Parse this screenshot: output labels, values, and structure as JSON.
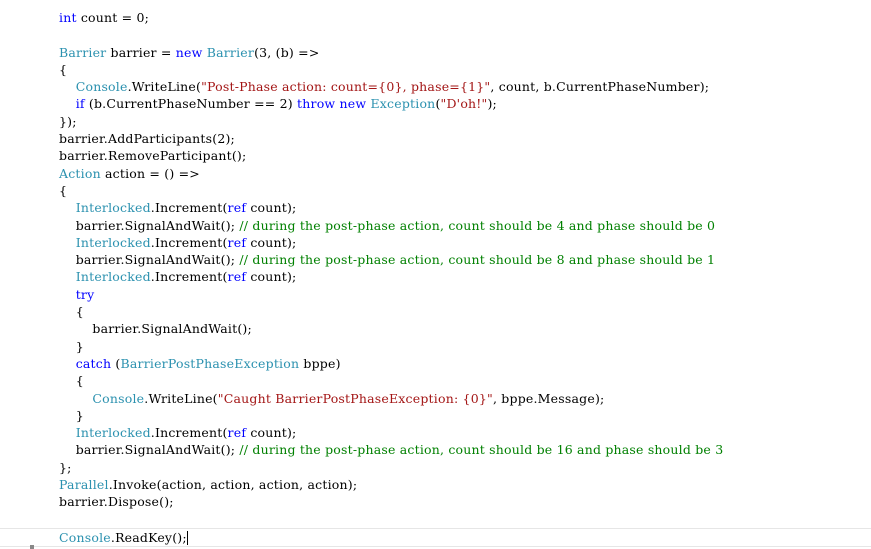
{
  "colors": {
    "keyword": "#0000ff",
    "type": "#2b91af",
    "string": "#a31515",
    "comment": "#008000",
    "plain": "#000000",
    "background": "#ffffff"
  },
  "editor": {
    "caret_line": 31,
    "lines": [
      [
        [
          "kw",
          "int"
        ],
        [
          "pl",
          " count = 0;"
        ]
      ],
      [],
      [
        [
          "ty",
          "Barrier"
        ],
        [
          "pl",
          " barrier = "
        ],
        [
          "kw",
          "new"
        ],
        [
          "pl",
          " "
        ],
        [
          "ty",
          "Barrier"
        ],
        [
          "pl",
          "(3, (b) =>"
        ]
      ],
      [
        [
          "pl",
          "{"
        ]
      ],
      [
        [
          "pl",
          "    "
        ],
        [
          "ty",
          "Console"
        ],
        [
          "pl",
          ".WriteLine("
        ],
        [
          "str",
          "\"Post-Phase action: count={0}, phase={1}\""
        ],
        [
          "pl",
          ", count, b.CurrentPhaseNumber);"
        ]
      ],
      [
        [
          "pl",
          "    "
        ],
        [
          "kw",
          "if"
        ],
        [
          "pl",
          " (b.CurrentPhaseNumber == 2) "
        ],
        [
          "kw",
          "throw"
        ],
        [
          "pl",
          " "
        ],
        [
          "kw",
          "new"
        ],
        [
          "pl",
          " "
        ],
        [
          "ty",
          "Exception"
        ],
        [
          "pl",
          "("
        ],
        [
          "str",
          "\"D'oh!\""
        ],
        [
          "pl",
          ");"
        ]
      ],
      [
        [
          "pl",
          "});"
        ]
      ],
      [
        [
          "pl",
          "barrier.AddParticipants(2);"
        ]
      ],
      [
        [
          "pl",
          "barrier.RemoveParticipant();"
        ]
      ],
      [
        [
          "ty",
          "Action"
        ],
        [
          "pl",
          " action = () =>"
        ]
      ],
      [
        [
          "pl",
          "{"
        ]
      ],
      [
        [
          "pl",
          "    "
        ],
        [
          "ty",
          "Interlocked"
        ],
        [
          "pl",
          ".Increment("
        ],
        [
          "kw",
          "ref"
        ],
        [
          "pl",
          " count);"
        ]
      ],
      [
        [
          "pl",
          "    barrier.SignalAndWait(); "
        ],
        [
          "com",
          "// during the post-phase action, count should be 4 and phase should be 0"
        ]
      ],
      [
        [
          "pl",
          "    "
        ],
        [
          "ty",
          "Interlocked"
        ],
        [
          "pl",
          ".Increment("
        ],
        [
          "kw",
          "ref"
        ],
        [
          "pl",
          " count);"
        ]
      ],
      [
        [
          "pl",
          "    barrier.SignalAndWait(); "
        ],
        [
          "com",
          "// during the post-phase action, count should be 8 and phase should be 1"
        ]
      ],
      [
        [
          "pl",
          "    "
        ],
        [
          "ty",
          "Interlocked"
        ],
        [
          "pl",
          ".Increment("
        ],
        [
          "kw",
          "ref"
        ],
        [
          "pl",
          " count);"
        ]
      ],
      [
        [
          "pl",
          "    "
        ],
        [
          "kw",
          "try"
        ]
      ],
      [
        [
          "pl",
          "    {"
        ]
      ],
      [
        [
          "pl",
          "        barrier.SignalAndWait();"
        ]
      ],
      [
        [
          "pl",
          "    }"
        ]
      ],
      [
        [
          "pl",
          "    "
        ],
        [
          "kw",
          "catch"
        ],
        [
          "pl",
          " ("
        ],
        [
          "ty",
          "BarrierPostPhaseException"
        ],
        [
          "pl",
          " bppe)"
        ]
      ],
      [
        [
          "pl",
          "    {"
        ]
      ],
      [
        [
          "pl",
          "        "
        ],
        [
          "ty",
          "Console"
        ],
        [
          "pl",
          ".WriteLine("
        ],
        [
          "str",
          "\"Caught BarrierPostPhaseException: {0}\""
        ],
        [
          "pl",
          ", bppe.Message);"
        ]
      ],
      [
        [
          "pl",
          "    }"
        ]
      ],
      [
        [
          "pl",
          "    "
        ],
        [
          "ty",
          "Interlocked"
        ],
        [
          "pl",
          ".Increment("
        ],
        [
          "kw",
          "ref"
        ],
        [
          "pl",
          " count);"
        ]
      ],
      [
        [
          "pl",
          "    barrier.SignalAndWait(); "
        ],
        [
          "com",
          "// during the post-phase action, count should be 16 and phase should be 3"
        ]
      ],
      [
        [
          "pl",
          "};"
        ]
      ],
      [
        [
          "ty",
          "Parallel"
        ],
        [
          "pl",
          ".Invoke(action, action, action, action);"
        ]
      ],
      [
        [
          "pl",
          "barrier.Dispose();"
        ]
      ],
      [],
      [
        [
          "ty",
          "Console"
        ],
        [
          "pl",
          ".ReadKey();"
        ]
      ]
    ]
  }
}
